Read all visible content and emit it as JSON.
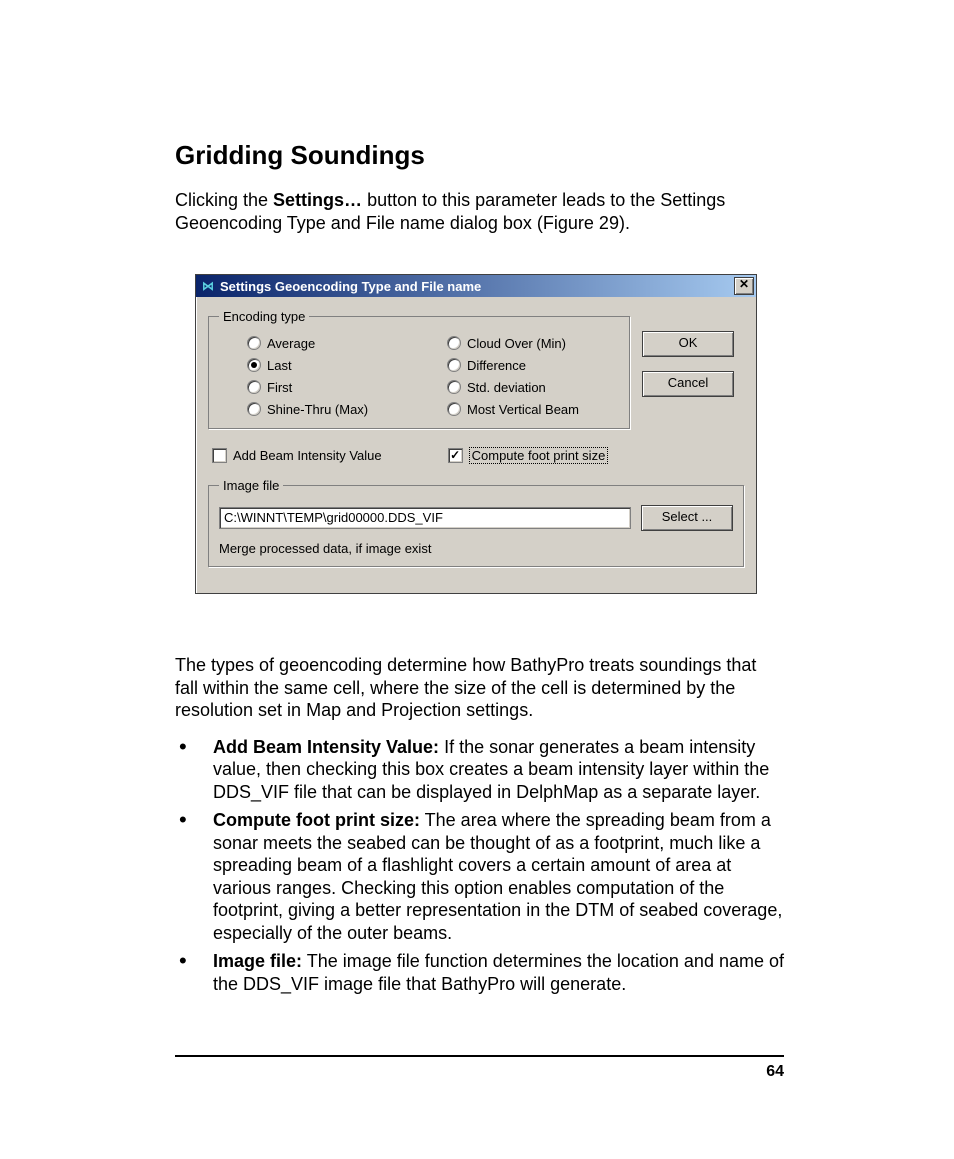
{
  "heading": "Gridding Soundings",
  "intro_pre": "Clicking the ",
  "intro_bold": "Settings…",
  "intro_post": " button to this parameter leads to the Settings Geoencoding Type and File name dialog box (Figure 29).",
  "dialog": {
    "title": "Settings Geoencoding Type and File name",
    "close_glyph": "✕",
    "encoding_legend": "Encoding type",
    "radios_left": [
      "Average",
      "Last",
      "First",
      "Shine-Thru (Max)"
    ],
    "radios_right": [
      "Cloud Over (Min)",
      "Difference",
      "Std. deviation",
      "Most Vertical Beam"
    ],
    "selected_radio": "Last",
    "ok_label": "OK",
    "cancel_label": "Cancel",
    "cb_add_beam": "Add Beam Intensity Value",
    "cb_add_beam_checked": false,
    "cb_footprint": "Compute foot print size",
    "cb_footprint_checked": true,
    "image_legend": "Image file",
    "path_value": "C:\\WINNT\\TEMP\\grid00000.DDS_VIF",
    "select_label": "Select ...",
    "merge_note": "Merge processed data, if image exist"
  },
  "para_after": "The types of geoencoding determine how BathyPro treats soundings that fall within the same cell, where the size of the cell is determined by the resolution set in Map and Projection settings.",
  "bullets": [
    {
      "bold": "Add Beam Intensity Value:",
      "text": " If the sonar generates a beam intensity value, then checking this box creates a beam intensity layer within the DDS_VIF file that can be displayed in DelphMap as a separate layer."
    },
    {
      "bold": "Compute foot print size:",
      "text": " The area where the spreading beam from a sonar meets the seabed can be thought of as a footprint, much like a spreading beam of a flashlight covers a certain amount of area at various ranges. Checking this option enables computation of the footprint, giving a better representation in the DTM of seabed coverage, especially of the outer beams."
    },
    {
      "bold": "Image file:",
      "text": " The image file function determines the location and name of the DDS_VIF image file that BathyPro will generate."
    }
  ],
  "page_number": "64"
}
